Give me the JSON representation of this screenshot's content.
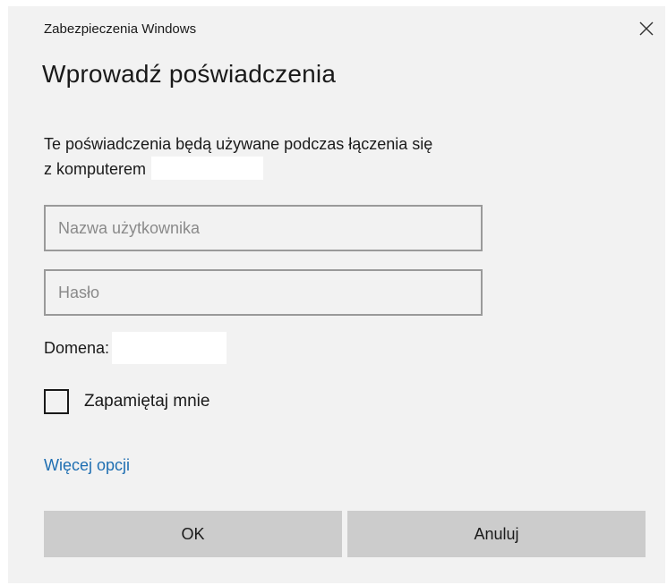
{
  "window": {
    "title": "Zabezpieczenia Windows",
    "close_icon": "close-icon"
  },
  "dialog": {
    "heading": "Wprowadź poświadczenia",
    "description_line1": "Te poświadczenia będą używane podczas łączenia się",
    "description_line2": "z komputerem",
    "username": {
      "placeholder": "Nazwa użytkownika",
      "value": ""
    },
    "password": {
      "placeholder": "Hasło",
      "value": ""
    },
    "domain_label": "Domena:",
    "remember_label": "Zapamiętaj mnie",
    "remember_checked": false,
    "more_options": "Więcej opcji",
    "ok_label": "OK",
    "cancel_label": "Anuluj"
  },
  "colors": {
    "dialog_bg": "#f2f2f2",
    "link": "#1f6fb2",
    "button_bg": "#cccccc",
    "field_border": "#9a9a9a"
  }
}
